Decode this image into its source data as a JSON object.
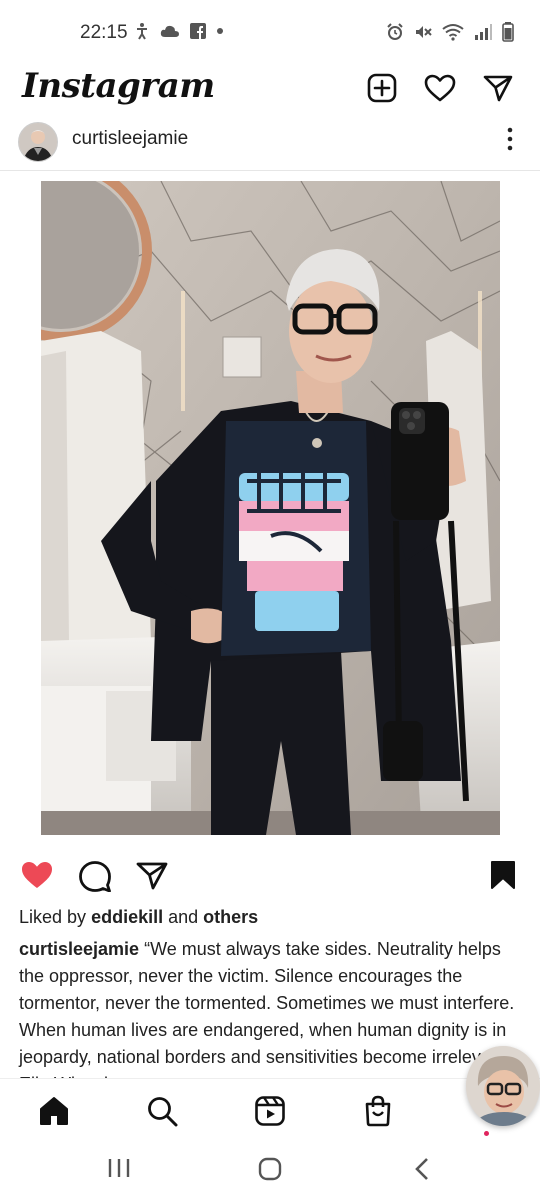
{
  "status_bar": {
    "time": "22:15"
  },
  "app": {
    "logo": "Instagram"
  },
  "post": {
    "username": "curtisleejamie",
    "liked_by_prefix": "Liked by",
    "liked_by_user": "eddiekill",
    "liked_by_and": "and",
    "liked_by_others": "others",
    "caption_user": "curtisleejamie",
    "caption_text": "“We must always take sides. Neutrality helps the oppressor, never the victim. Silence encourages the tormentor, never the tormented. Sometimes we must interfere. When human lives are endangered, when human dignity is in jeopardy, national borders and sensitivities become irrelevant.” Elie Wiesel",
    "liked": true,
    "saved": true
  },
  "colors": {
    "like": "#ed4956",
    "text": "#222222",
    "jacket": "#15161c",
    "trans_blue": "#8fd0ee",
    "trans_pink": "#f2a9c4"
  },
  "icons": [
    "new-post-icon",
    "heart-icon",
    "direct-message-icon",
    "more-vertical-icon",
    "like-filled-icon",
    "comment-icon",
    "share-icon",
    "bookmark-filled-icon",
    "home-icon",
    "search-icon",
    "reels-icon",
    "shop-icon",
    "profile-icon"
  ]
}
